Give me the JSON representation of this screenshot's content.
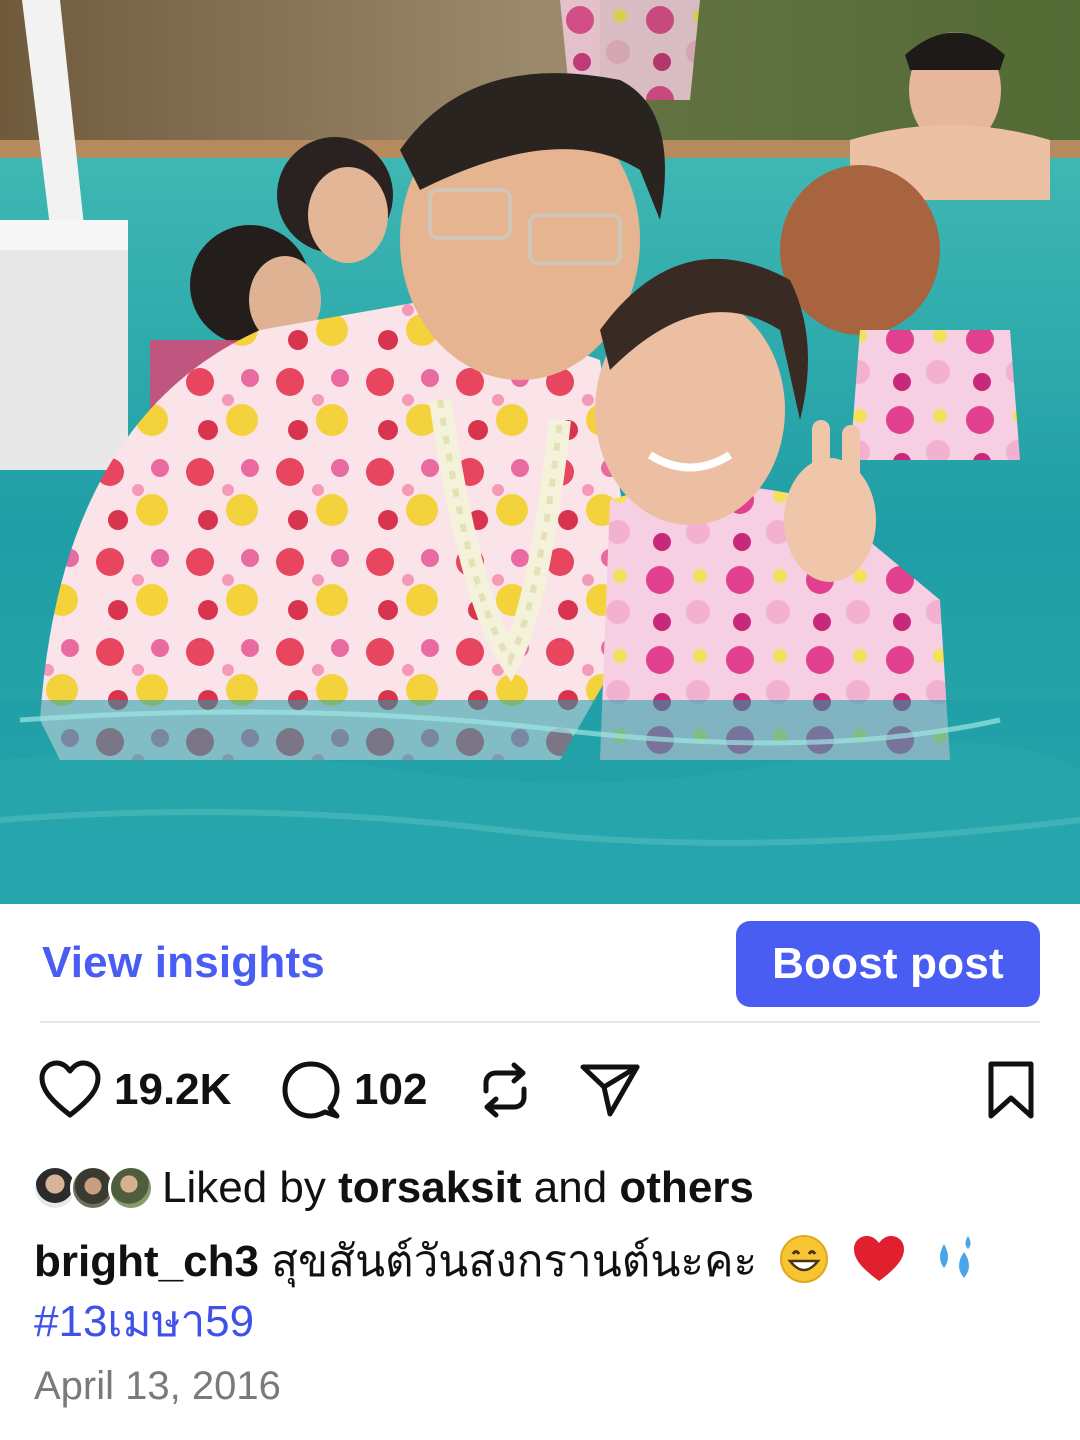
{
  "post": {
    "photo_icon": "post-photo",
    "view_insights_label": "View insights",
    "boost_label": "Boost post"
  },
  "engagement": {
    "likes": "19.2K",
    "comments": "102",
    "icons": [
      "heart-icon",
      "comment-icon",
      "repost-icon",
      "share-icon",
      "bookmark-icon"
    ]
  },
  "liked_by": {
    "prefix": "Liked by ",
    "user": "torsaksit",
    "middle": " and ",
    "others": "others"
  },
  "caption": {
    "username": "bright_ch3",
    "text": "สุขสันต์วันสงกรานต์นะคะ",
    "emojis": [
      "grinning-face-emoji",
      "red-heart-emoji",
      "sweat-droplets-emoji"
    ],
    "hashtag": "#13เมษา59"
  },
  "date": "April 13, 2016",
  "colors": {
    "accent": "#4a5df2",
    "hashtag": "#3f51e8",
    "muted": "#7a7a7a",
    "pool": "#2aa7a8"
  }
}
